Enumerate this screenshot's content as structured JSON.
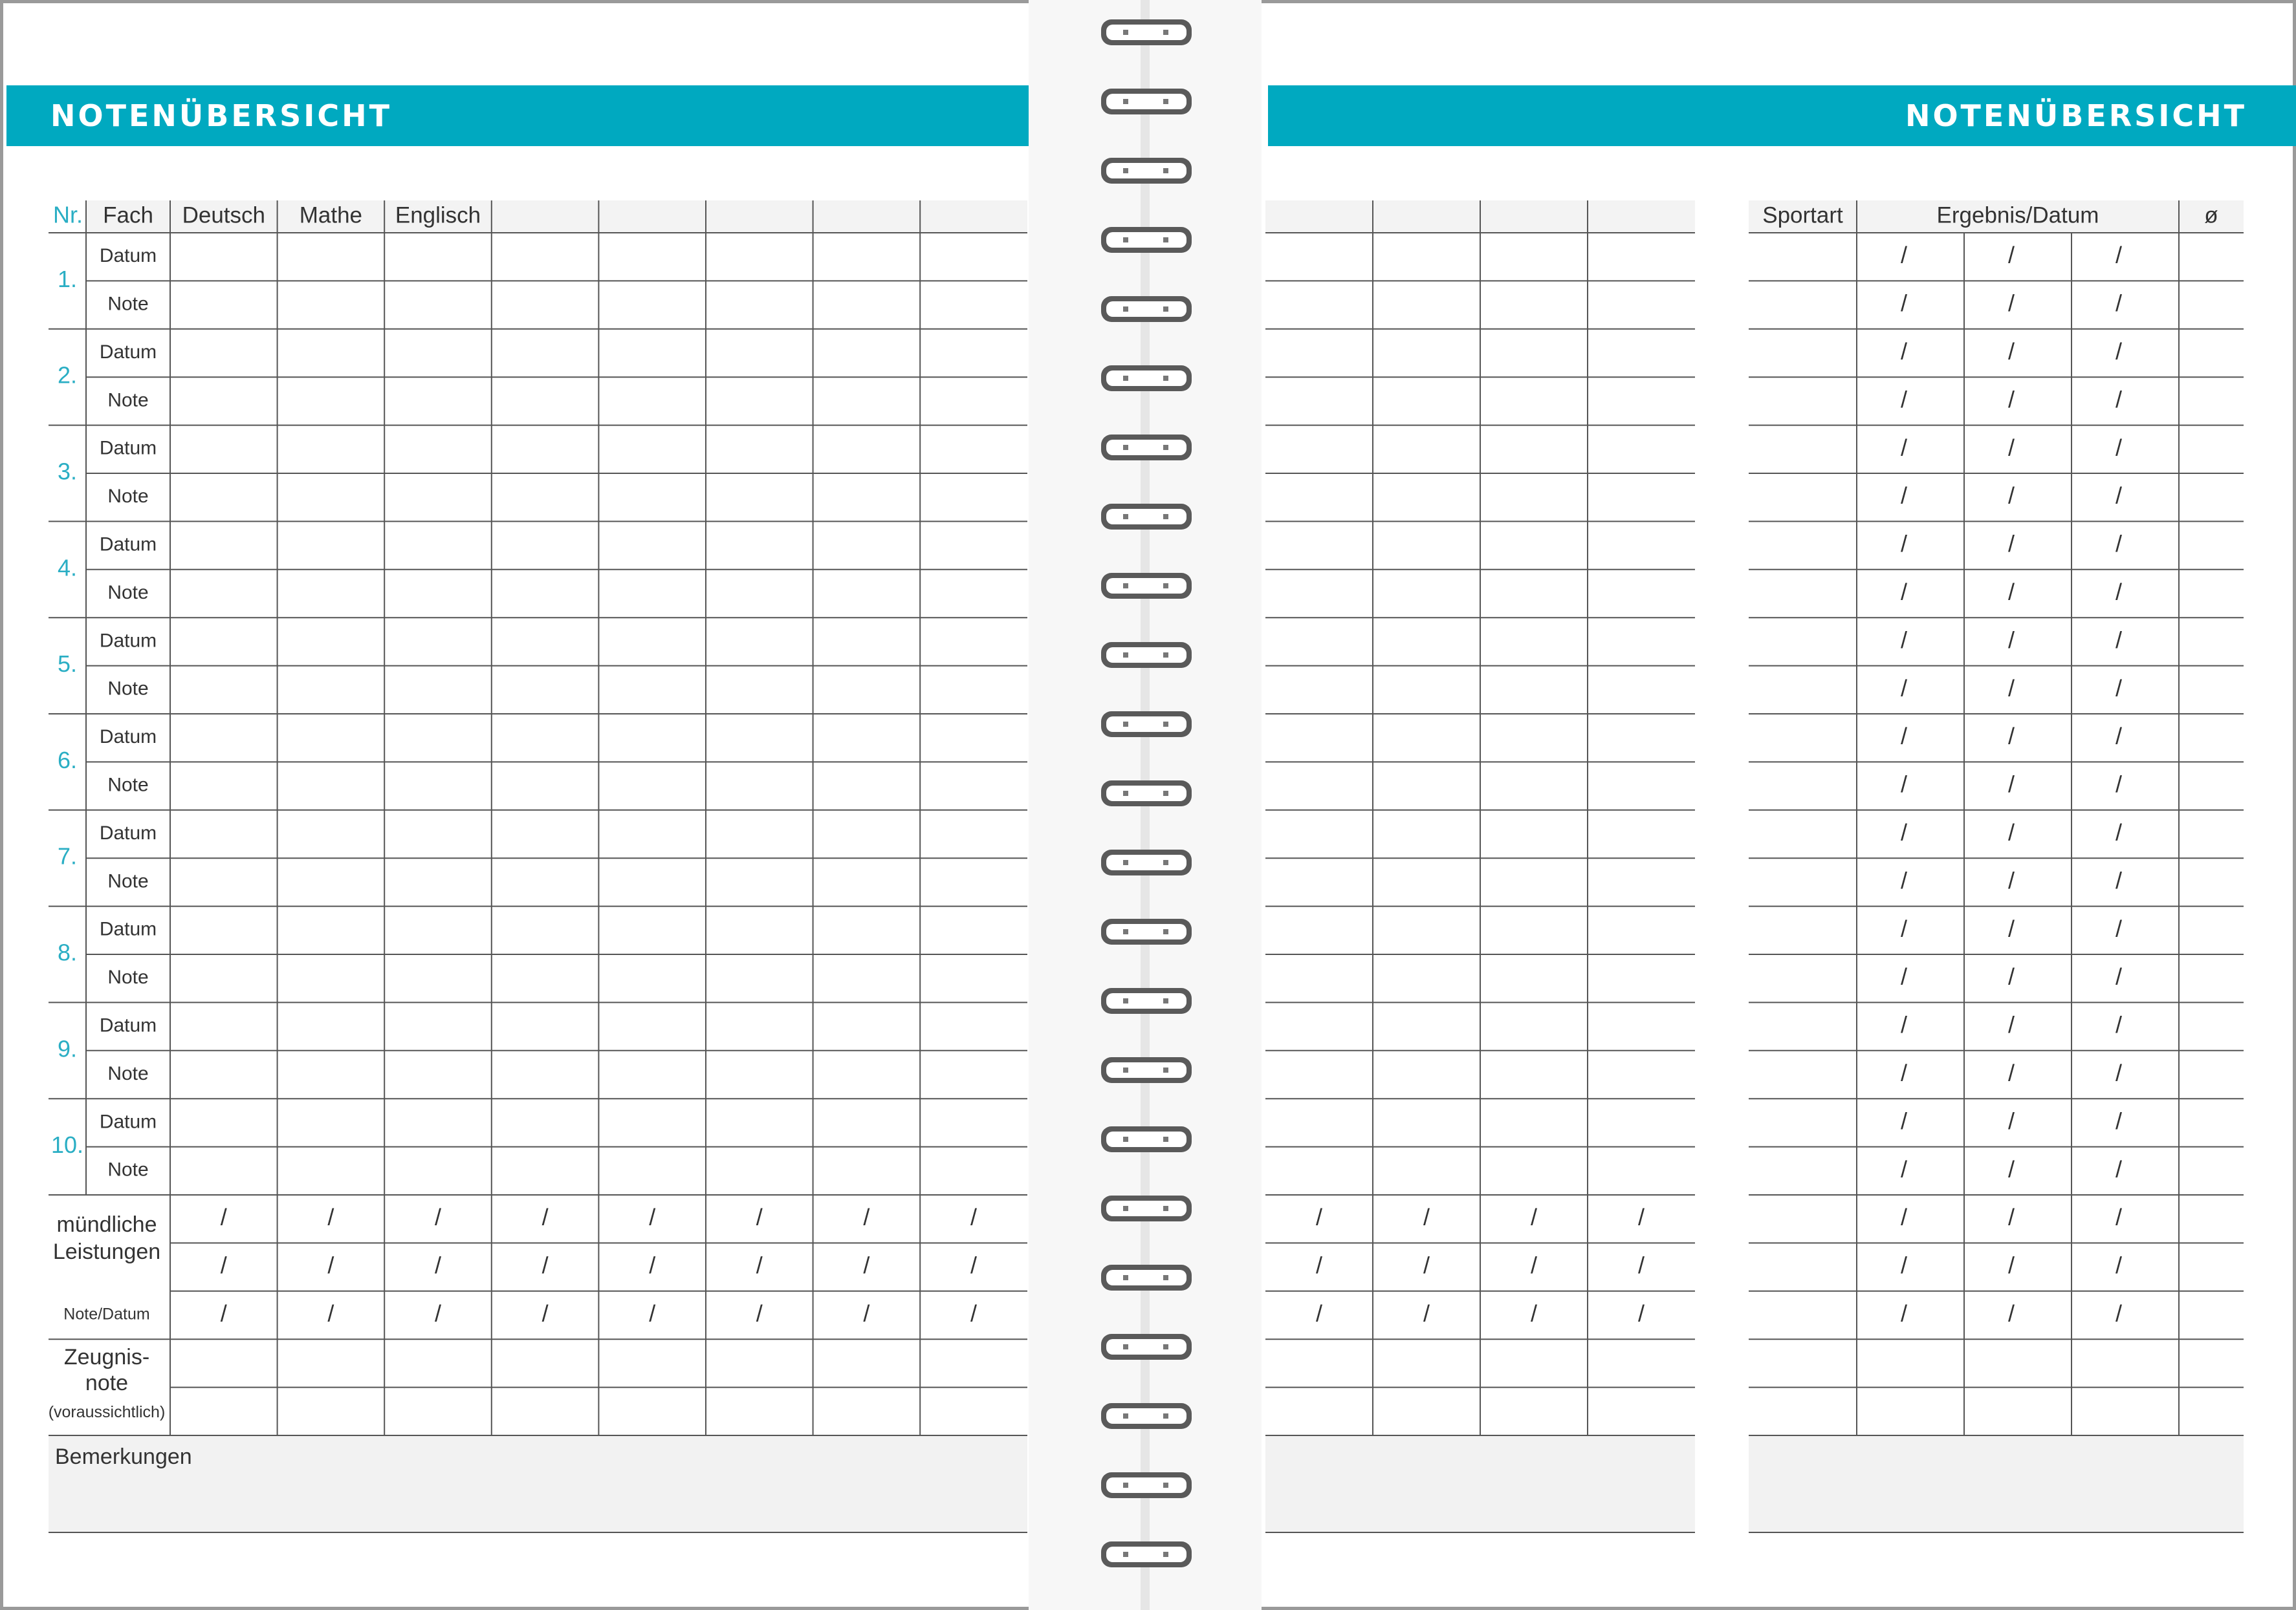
{
  "left_page": {
    "title": "NOTENÜBERSICHT",
    "header": {
      "nr": "Nr.",
      "fach": "Fach",
      "subjects": [
        "Deutsch",
        "Mathe",
        "Englisch",
        "",
        "",
        "",
        "",
        ""
      ]
    },
    "entries": [
      {
        "nr": "1.",
        "datum": "Datum",
        "note": "Note"
      },
      {
        "nr": "2.",
        "datum": "Datum",
        "note": "Note"
      },
      {
        "nr": "3.",
        "datum": "Datum",
        "note": "Note"
      },
      {
        "nr": "4.",
        "datum": "Datum",
        "note": "Note"
      },
      {
        "nr": "5.",
        "datum": "Datum",
        "note": "Note"
      },
      {
        "nr": "6.",
        "datum": "Datum",
        "note": "Note"
      },
      {
        "nr": "7.",
        "datum": "Datum",
        "note": "Note"
      },
      {
        "nr": "8.",
        "datum": "Datum",
        "note": "Note"
      },
      {
        "nr": "9.",
        "datum": "Datum",
        "note": "Note"
      },
      {
        "nr": "10.",
        "datum": "Datum",
        "note": "Note"
      }
    ],
    "oral": {
      "line1": "mündliche",
      "line2": "Leistungen",
      "sub": "Note/Datum"
    },
    "report": {
      "line1": "Zeugnis-",
      "line2": "note",
      "sub": "(voraussichtlich)"
    },
    "remarks": "Bemerkungen",
    "slash": "/"
  },
  "right_page": {
    "title": "NOTENÜBERSICHT",
    "sport_header": {
      "sportart": "Sportart",
      "ergebnis": "Ergebnis/Datum",
      "avg": "ø"
    },
    "slash": "/"
  },
  "colors": {
    "accent": "#00a9c0",
    "number": "#2aaec4",
    "header_fill": "#f3f3f3",
    "remarks_fill": "#f2f2f2",
    "line": "#555555",
    "frame": "#9a9a9a"
  }
}
